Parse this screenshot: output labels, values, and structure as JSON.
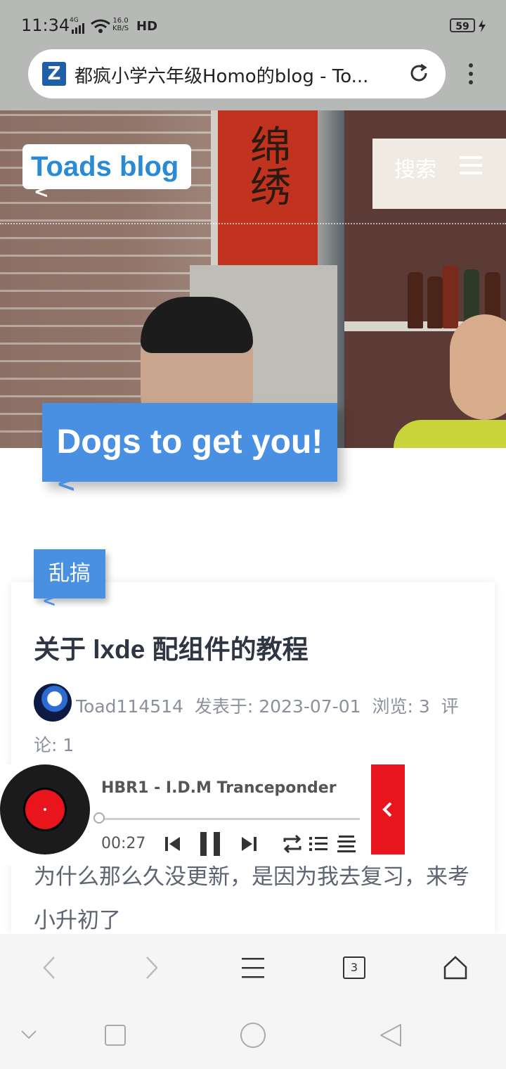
{
  "status_bar": {
    "time": "11:34",
    "network_type": "4G",
    "speed_value": "16.0",
    "speed_unit": "KB/S",
    "hd_label": "HD",
    "battery": "59"
  },
  "address_bar": {
    "site_icon": "Z",
    "title": "都疯小学六年级Homo的blog - To..."
  },
  "header": {
    "logo": "Toads blog",
    "search_label": "搜索"
  },
  "hero": {
    "banner_text": "绵绣",
    "tagline": "Dogs to get you!"
  },
  "post": {
    "category": "乱搞",
    "title": "关于 lxde 配组件的教程",
    "author": "Toad114514",
    "published_label": "发表于:",
    "published_date": "2023-07-01",
    "views_label": "浏览:",
    "views": "3",
    "comments_label_a": "评",
    "comments_label_b": "论:",
    "comments": "1",
    "excerpt": "为什么那么久没更新，是因为我去复习，来考小升初了"
  },
  "player": {
    "song": "HBR1 - I.D.M Tranceponder",
    "time": "00:27",
    "progress": 0.0
  },
  "browser_bar": {
    "tab_count": "3"
  },
  "icons": [
    "site-z-icon",
    "reload-icon",
    "more-icon",
    "hamburger-menu-icon",
    "avatar",
    "vinyl-disc-icon",
    "previous-icon",
    "pause-icon",
    "next-icon",
    "repeat-icon",
    "playlist-icon",
    "lyrics-icon",
    "collapse-chevron-icon",
    "back-icon",
    "forward-icon",
    "menu-icon",
    "tabs-icon",
    "home-icon",
    "nav-down-icon",
    "nav-recent-icon",
    "nav-home-icon",
    "nav-back-icon"
  ],
  "colors": {
    "accent_blue": "#4a90e2",
    "logo_blue": "#2a8ad4",
    "player_red": "#e8151c"
  }
}
